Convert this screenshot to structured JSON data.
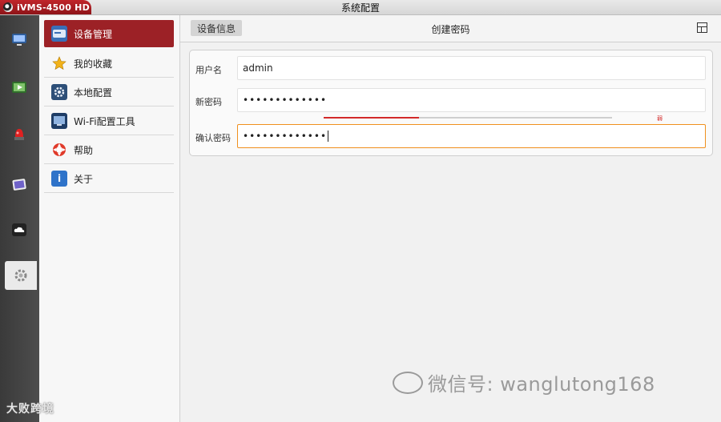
{
  "titlebar": {
    "app_name": "iVMS-4500 HD",
    "window_title": "系统配置"
  },
  "rail": {
    "items": [
      {
        "icon": "live-view-icon",
        "color": "#3a6fb7"
      },
      {
        "icon": "playback-icon",
        "color": "#4a8c3a"
      },
      {
        "icon": "alarm-icon",
        "color": "#d42020"
      },
      {
        "icon": "picture-icon",
        "color": "#6f62c8"
      },
      {
        "icon": "cloud-icon",
        "color": "#333333"
      },
      {
        "icon": "settings-icon",
        "color": "#8a8a8a",
        "active": true
      }
    ]
  },
  "menu": {
    "items": [
      {
        "label": "设备管理",
        "icon": "device-management-icon",
        "active": true
      },
      {
        "label": "我的收藏",
        "icon": "star-icon"
      },
      {
        "label": "本地配置",
        "icon": "local-config-icon"
      },
      {
        "label": "Wi-Fi配置工具",
        "icon": "wifi-tool-icon"
      },
      {
        "label": "帮助",
        "icon": "help-icon"
      },
      {
        "label": "关于",
        "icon": "info-icon"
      }
    ]
  },
  "content": {
    "tab_label": "设备信息",
    "title": "创建密码",
    "form": {
      "username_label": "用户名",
      "username_value": "admin",
      "new_password_label": "新密码",
      "new_password_value": "•••••••••••••",
      "confirm_password_label": "确认密码",
      "confirm_password_value": "•••••••••••••",
      "strength_text": "弱",
      "strength_level": 0.33
    }
  },
  "watermark": {
    "text": "微信号: wanglutong168",
    "bottom_left": "大败跨境"
  },
  "colors": {
    "accent": "#9c2126",
    "focus": "#f0901e",
    "strength": "#d32a2a"
  }
}
